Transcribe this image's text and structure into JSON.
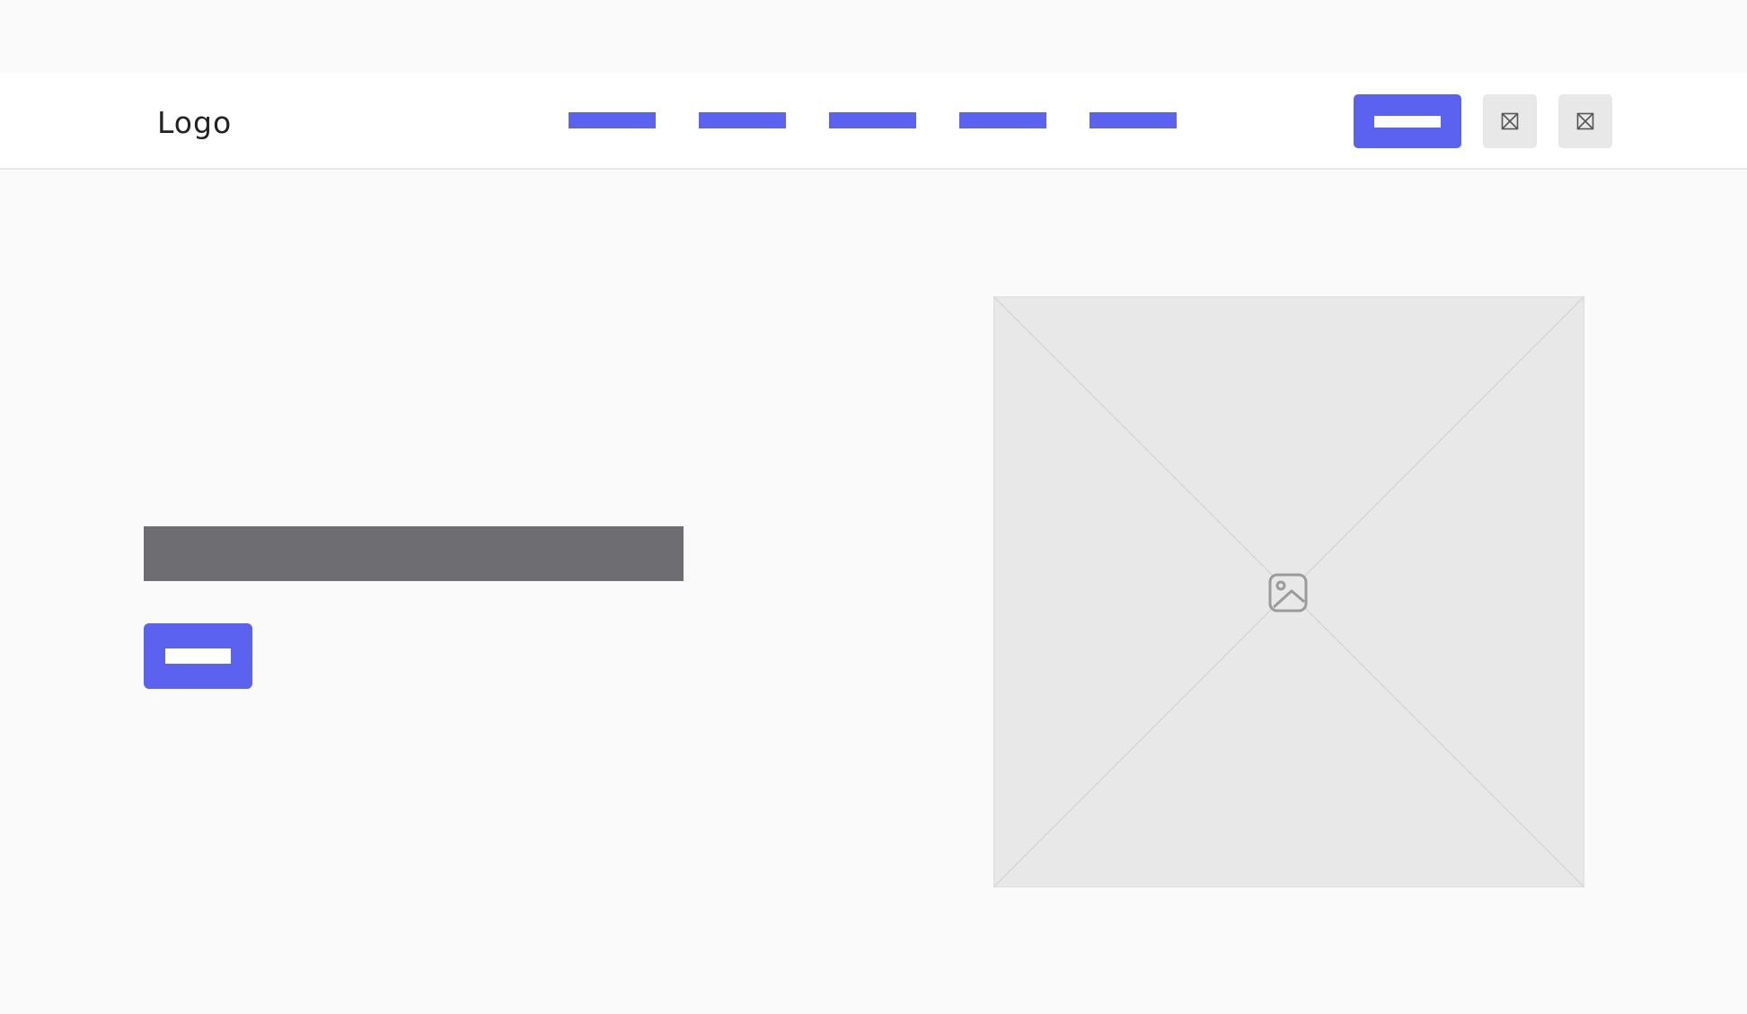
{
  "colors": {
    "accent": "#5a62ef",
    "headline_placeholder": "#6e6d71",
    "image_placeholder": "#e8e8e8",
    "icon_gray": "#9b9b9b"
  },
  "header": {
    "logo": "Logo",
    "nav_links": [
      "",
      "",
      "",
      "",
      ""
    ],
    "primary_button_label": "",
    "icon_buttons": [
      {
        "icon": "placeholder-box-icon"
      },
      {
        "icon": "placeholder-box-icon"
      }
    ]
  },
  "hero": {
    "headline": "",
    "cta_label": "",
    "image_icon": "image-icon"
  }
}
